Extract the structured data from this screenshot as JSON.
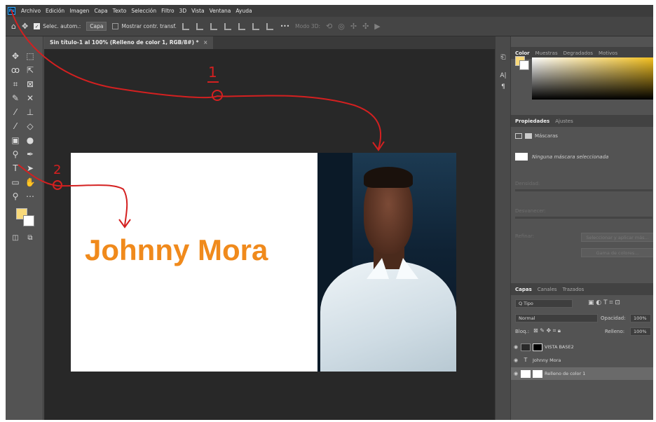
{
  "menubar": {
    "app_icon": "ps-logo-icon",
    "app_letters": "Ps",
    "items": [
      "Archivo",
      "Edición",
      "Imagen",
      "Capa",
      "Texto",
      "Selección",
      "Filtro",
      "3D",
      "Vista",
      "Ventana",
      "Ayuda"
    ]
  },
  "options": {
    "auto_select_label": "Selec. autom.:",
    "auto_select_value": "Capa",
    "transform_label": "Mostrar contr. transf.",
    "more": "•••",
    "mode_3d": "Modo 3D:"
  },
  "document": {
    "tab_title": "Sin título-1 al 100% (Relleno de color 1, RGB/8#) *",
    "headline": "Johnny Mora",
    "colors": {
      "headline": "#f08a1c",
      "foreground": "#f8d97a"
    }
  },
  "annotations": {
    "label_1": "1",
    "label_2": "2",
    "color": "#d42020"
  },
  "panels": {
    "color_tabs": [
      "Color",
      "Muestras",
      "Degradados",
      "Motivos"
    ],
    "properties_tabs": [
      "Propiedades",
      "Ajustes"
    ],
    "masks_label": "Máscaras",
    "no_mask": "Ninguna máscara seleccionada",
    "density": "Densidad:",
    "feather": "Desvanecer:",
    "refine": "Refinar:",
    "select_mask_btn": "Seleccionar y aplicar más...",
    "color_range_btn": "Gama de colores...",
    "layers_tabs": [
      "Capas",
      "Canales",
      "Trazados"
    ],
    "kind_filter": "Q Tipo",
    "blend_mode": "Normal",
    "opacity_label": "Opacidad:",
    "opacity_value": "100%",
    "lock_label": "Bloq.:",
    "fill_label": "Relleno:",
    "fill_value": "100%",
    "layers": [
      {
        "name": "VISTA BASE2",
        "type": "image"
      },
      {
        "name": "Johnny Mora",
        "type": "text"
      },
      {
        "name": "Relleno de color 1",
        "type": "fill"
      }
    ]
  }
}
